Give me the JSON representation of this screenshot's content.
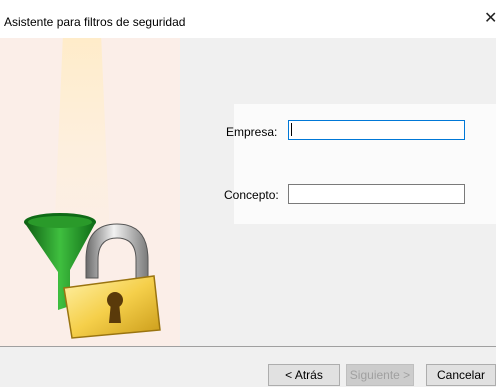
{
  "window": {
    "title": "Asistente para filtros de seguridad",
    "close_glyph": "✕"
  },
  "illustration": {
    "icons": [
      "funnel-icon",
      "padlock-icon"
    ],
    "colors": {
      "funnel": "#1f8a1f",
      "padlock_body": "#f2c94c",
      "shackle": "#9a9a9a"
    }
  },
  "form": {
    "empresa_label": "Empresa:",
    "empresa_value": "",
    "concepto_label": "Concepto:",
    "concepto_value": ""
  },
  "footer": {
    "back_label": "< Atrás",
    "next_label": "Siguiente >",
    "next_disabled": true,
    "cancel_label": "Cancelar"
  },
  "colors": {
    "focus_border": "#0078d7",
    "panel_background": "#f0f0f0"
  }
}
